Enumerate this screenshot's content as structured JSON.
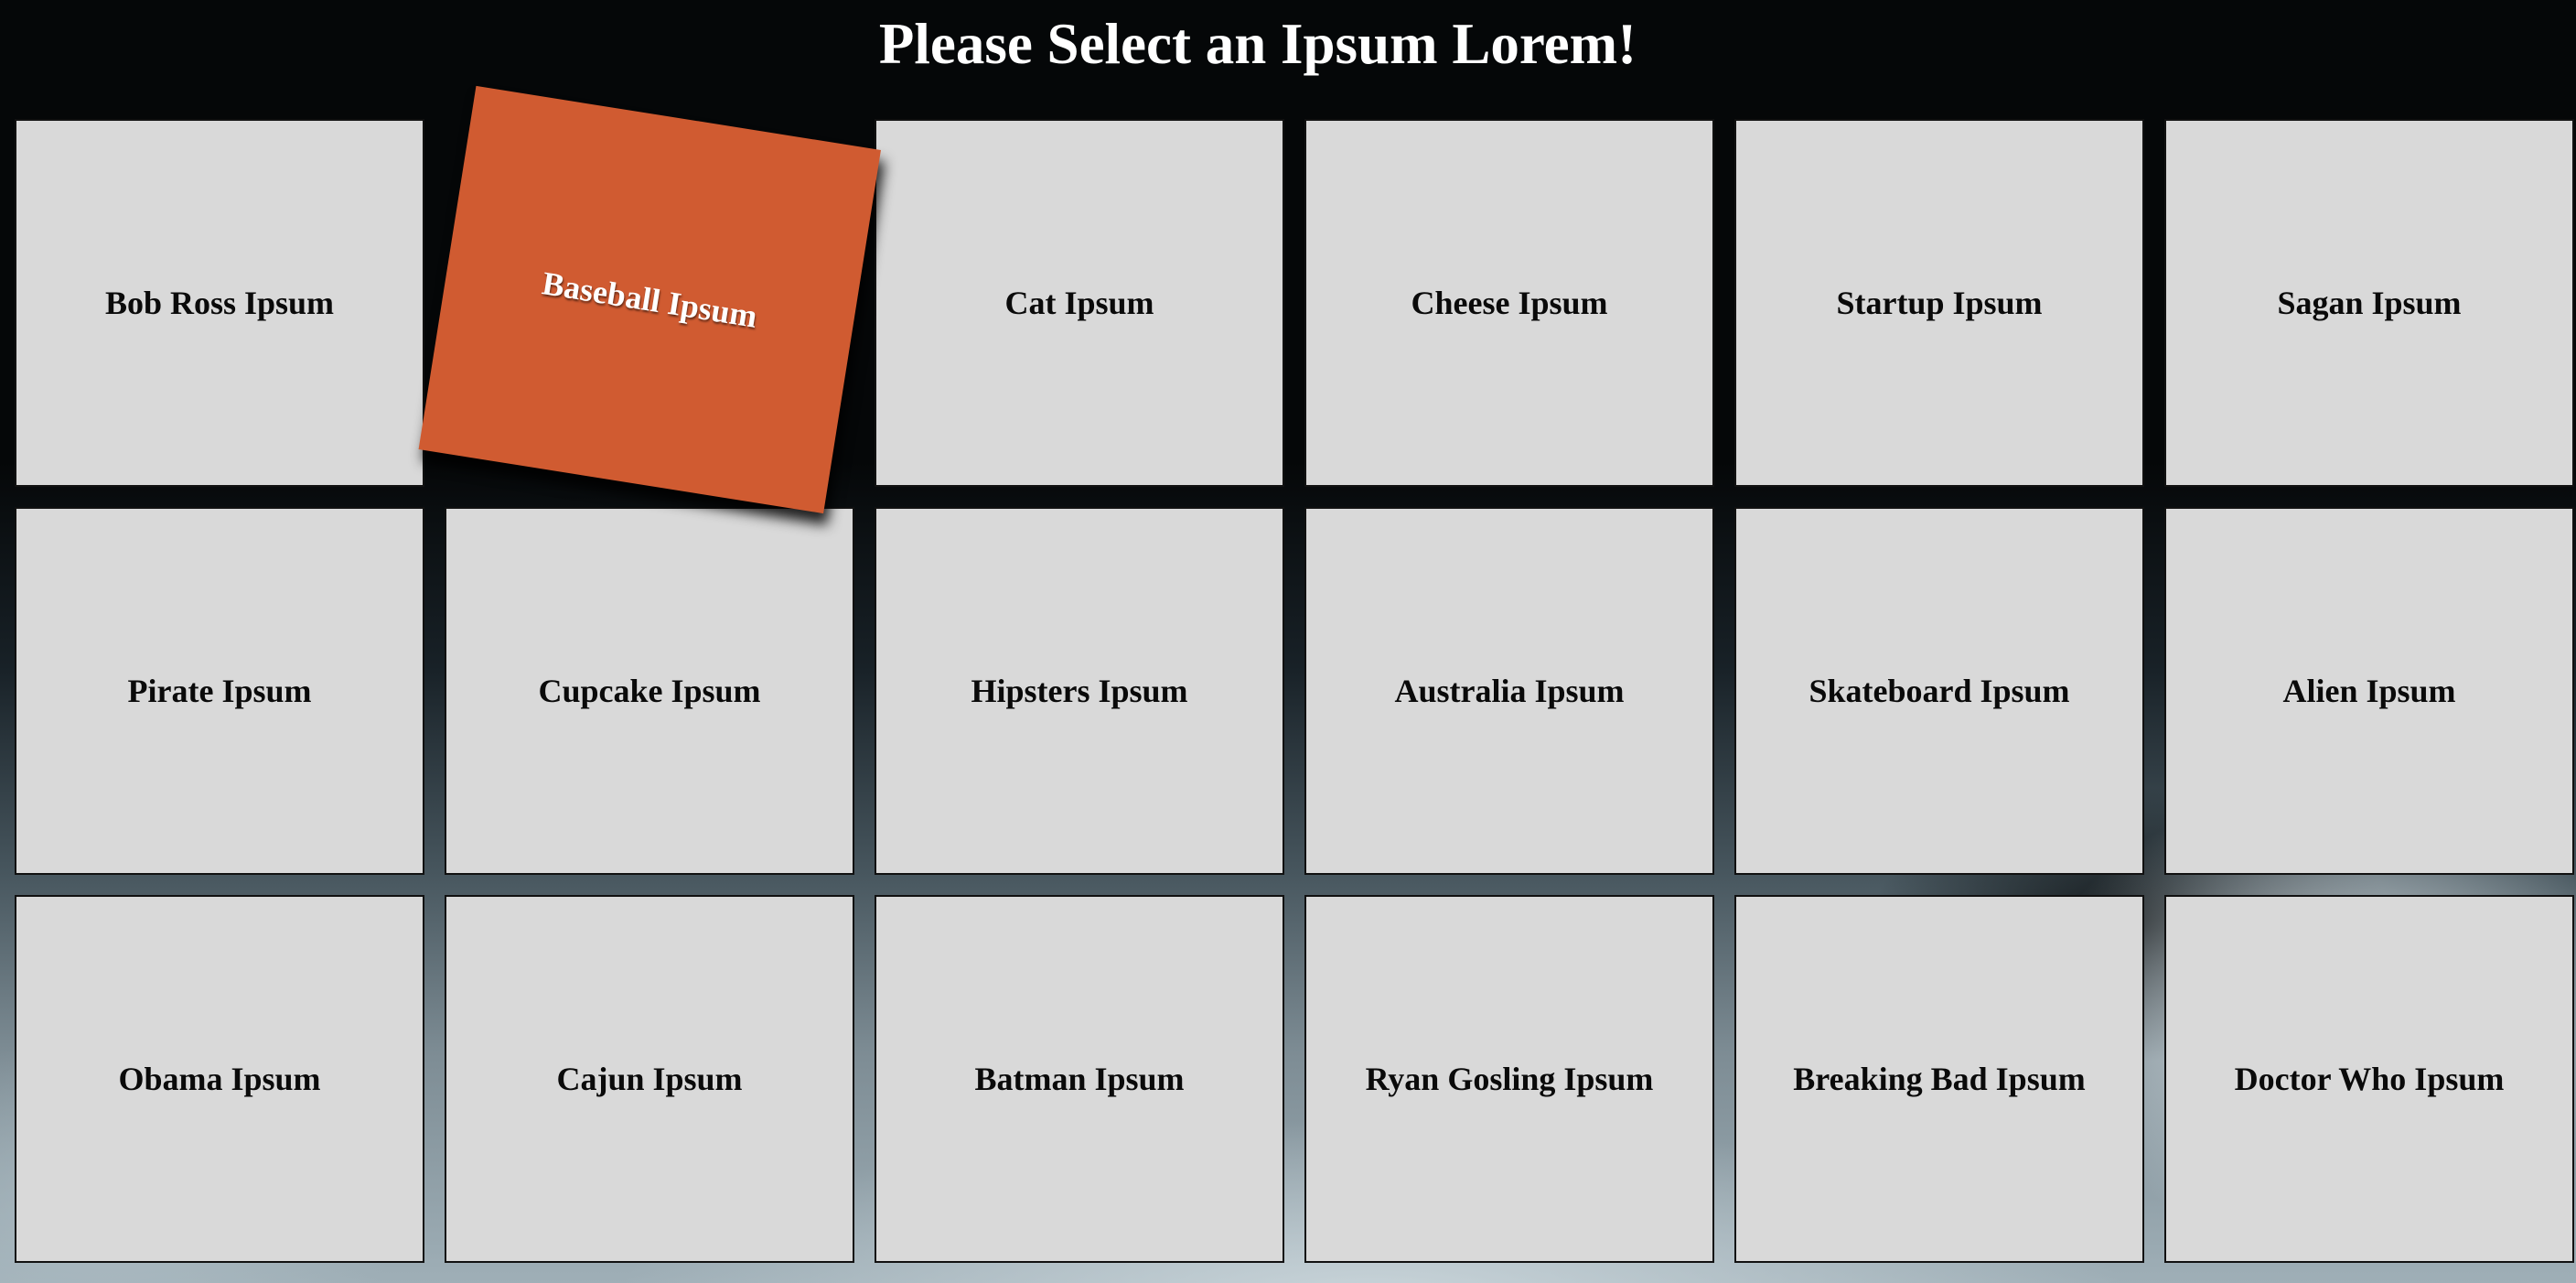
{
  "header": {
    "title": "Please Select an Ipsum Lorem!"
  },
  "tiles": [
    {
      "label": "Bob Ross Ipsum",
      "selected": false
    },
    {
      "label": "Baseball Ipsum",
      "selected": true
    },
    {
      "label": "Cat Ipsum",
      "selected": false
    },
    {
      "label": "Cheese Ipsum",
      "selected": false
    },
    {
      "label": "Startup Ipsum",
      "selected": false
    },
    {
      "label": "Sagan Ipsum",
      "selected": false
    },
    {
      "label": "Pirate Ipsum",
      "selected": false
    },
    {
      "label": "Cupcake Ipsum",
      "selected": false
    },
    {
      "label": "Hipsters Ipsum",
      "selected": false
    },
    {
      "label": "Australia Ipsum",
      "selected": false
    },
    {
      "label": "Skateboard Ipsum",
      "selected": false
    },
    {
      "label": "Alien Ipsum",
      "selected": false
    },
    {
      "label": "Obama Ipsum",
      "selected": false
    },
    {
      "label": "Cajun Ipsum",
      "selected": false
    },
    {
      "label": "Batman Ipsum",
      "selected": false
    },
    {
      "label": "Ryan Gosling Ipsum",
      "selected": false
    },
    {
      "label": "Breaking Bad Ipsum",
      "selected": false
    },
    {
      "label": "Doctor Who Ipsum",
      "selected": false
    }
  ],
  "colors": {
    "tile_background": "#d9d9d9",
    "selected_tile_background": "#d05b31",
    "header_background": "#050708",
    "title_text": "#ffffff"
  }
}
